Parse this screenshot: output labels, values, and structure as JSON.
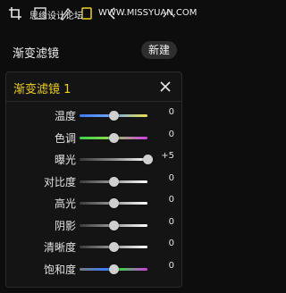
{
  "watermark": {
    "left": "思缘设计论坛",
    "right": "WWW.MISSYUAN.COM"
  },
  "toolbar": {
    "icons": [
      "crop-icon",
      "transform-icon",
      "brush-icon",
      "undo-icon",
      "share-icon",
      "settings-icon"
    ]
  },
  "section": {
    "title": "渐变滤镜",
    "new_button": "新建"
  },
  "panel": {
    "title": "渐变滤镜 1",
    "accent": "#f2d21a"
  },
  "sliders": [
    {
      "label": "温度",
      "value": "0",
      "level": 0.5,
      "track": "temperature"
    },
    {
      "label": "色调",
      "value": "0",
      "level": 0.5,
      "track": "tint"
    },
    {
      "label": "曝光",
      "value": "+5",
      "level": 1.0,
      "track": "exposure"
    },
    {
      "label": "对比度",
      "value": "0",
      "level": 0.5,
      "track": "contrast"
    },
    {
      "label": "高光",
      "value": "0",
      "level": 0.5,
      "track": "highlights"
    },
    {
      "label": "阴影",
      "value": "0",
      "level": 0.5,
      "track": "shadows"
    },
    {
      "label": "清晰度",
      "value": "0",
      "level": 0.5,
      "track": "clarity"
    },
    {
      "label": "饱和度",
      "value": "0",
      "level": 0.5,
      "track": "saturation"
    }
  ]
}
